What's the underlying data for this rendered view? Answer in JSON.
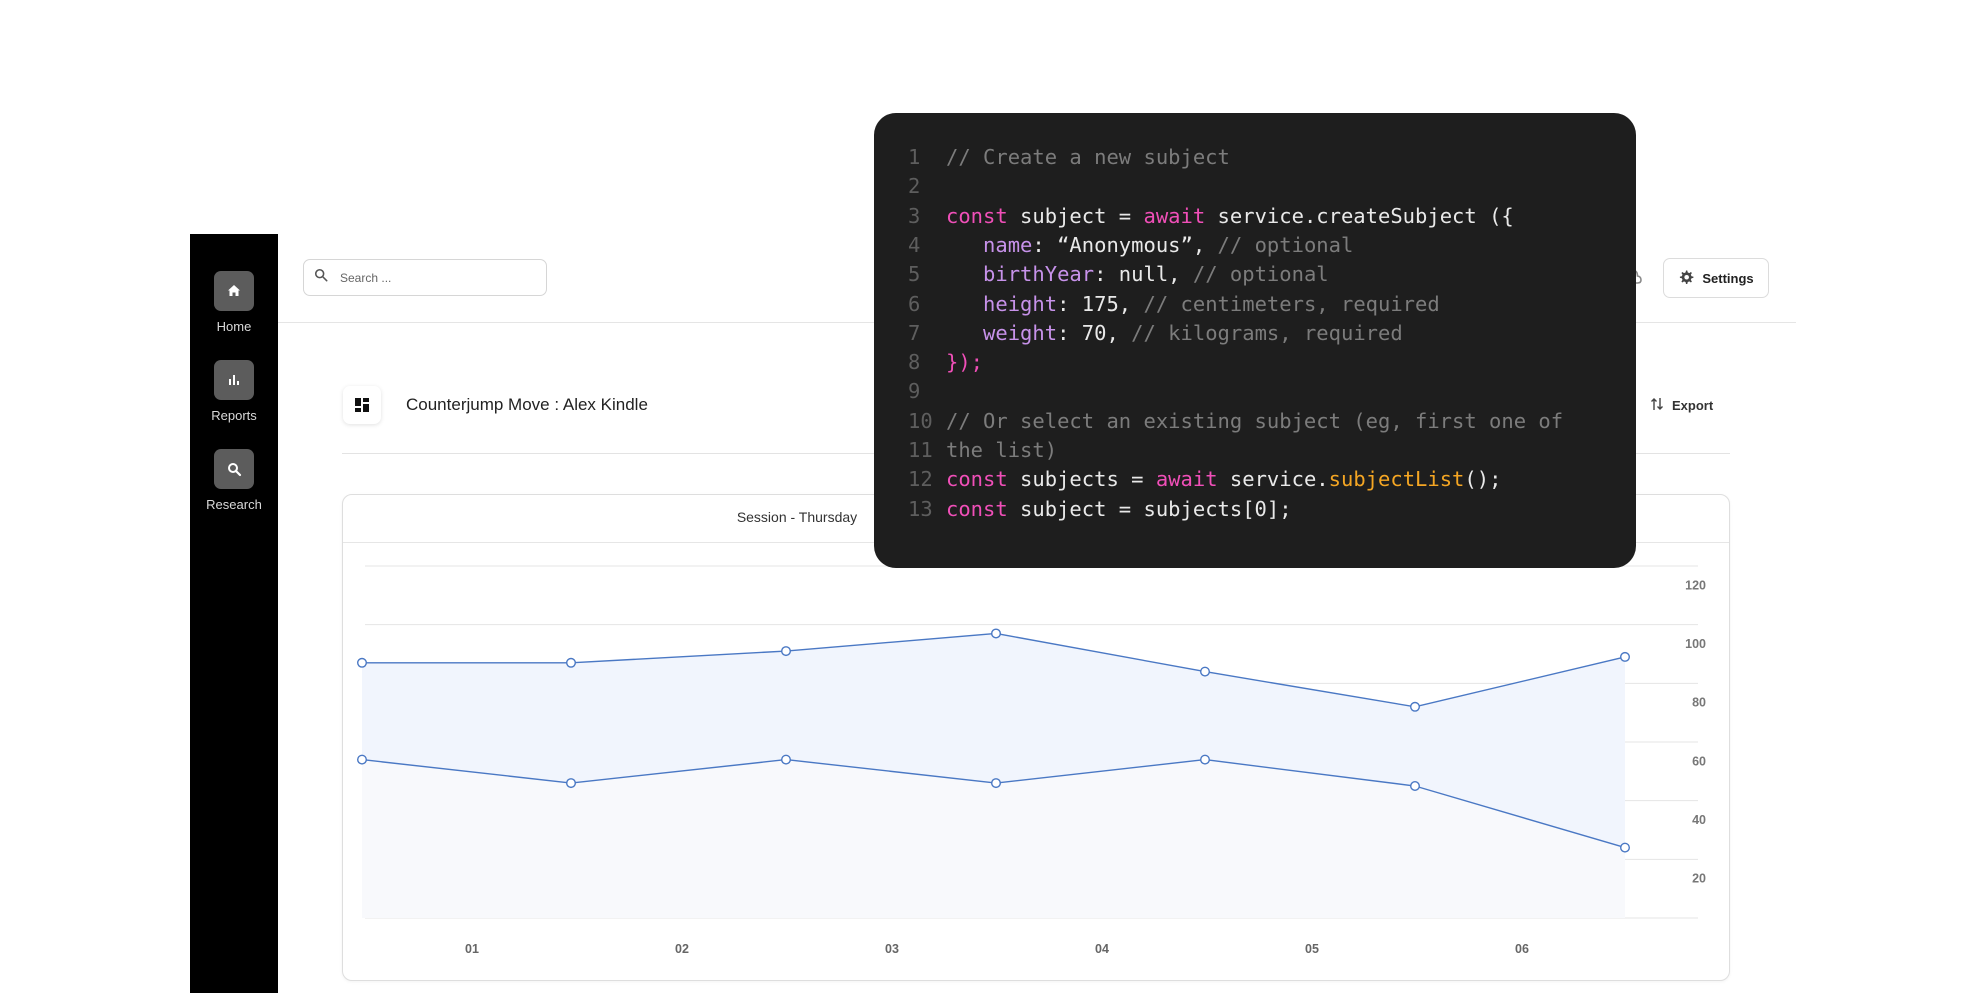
{
  "sidebar": {
    "items": [
      {
        "label": "Home",
        "icon": "home-icon"
      },
      {
        "label": "Reports",
        "icon": "bar-chart-icon"
      },
      {
        "label": "Research",
        "icon": "search-icon"
      }
    ]
  },
  "header": {
    "search_placeholder": "Search ...",
    "settings_label": "Settings"
  },
  "page": {
    "title": "Counterjump Move : Alex Kindle",
    "export_label": "Export"
  },
  "card": {
    "title": "Session - Thursday"
  },
  "code": {
    "lines": [
      {
        "n": "1",
        "segs": [
          {
            "t": "// Create a new subject",
            "c": "cm"
          }
        ]
      },
      {
        "n": "2",
        "segs": []
      },
      {
        "n": "3",
        "segs": [
          {
            "t": "const",
            "c": "kw"
          },
          {
            "t": " subject = ",
            "c": ""
          },
          {
            "t": "await",
            "c": "kw"
          },
          {
            "t": " service.createSubject ({",
            "c": ""
          }
        ]
      },
      {
        "n": "4",
        "segs": [
          {
            "t": "   ",
            "c": ""
          },
          {
            "t": "name",
            "c": "prop"
          },
          {
            "t": ": “Anonymous”, ",
            "c": ""
          },
          {
            "t": "// optional",
            "c": "cm"
          }
        ]
      },
      {
        "n": "5",
        "segs": [
          {
            "t": "   ",
            "c": ""
          },
          {
            "t": "birthYear",
            "c": "prop"
          },
          {
            "t": ": null, ",
            "c": ""
          },
          {
            "t": "// optional",
            "c": "cm"
          }
        ]
      },
      {
        "n": "6",
        "segs": [
          {
            "t": "   ",
            "c": ""
          },
          {
            "t": "height",
            "c": "prop"
          },
          {
            "t": ": 175, ",
            "c": ""
          },
          {
            "t": "// centimeters, required",
            "c": "cm"
          }
        ]
      },
      {
        "n": "7",
        "segs": [
          {
            "t": "   ",
            "c": ""
          },
          {
            "t": "weight",
            "c": "prop"
          },
          {
            "t": ": 70, ",
            "c": ""
          },
          {
            "t": "// kilograms, required",
            "c": "cm"
          }
        ]
      },
      {
        "n": "8",
        "segs": [
          {
            "t": "});",
            "c": "kw"
          }
        ]
      },
      {
        "n": "9",
        "segs": []
      },
      {
        "n": "10",
        "segs": [
          {
            "t": "// Or select an existing subject (eg, first one of",
            "c": "cm"
          }
        ]
      },
      {
        "n": "11",
        "segs": [
          {
            "t": "the list)",
            "c": "cm"
          }
        ]
      },
      {
        "n": "12",
        "segs": [
          {
            "t": "const",
            "c": "kw"
          },
          {
            "t": " subjects = ",
            "c": ""
          },
          {
            "t": "await",
            "c": "kw"
          },
          {
            "t": " service.",
            "c": ""
          },
          {
            "t": "subjectList",
            "c": "fn"
          },
          {
            "t": "();",
            "c": ""
          }
        ]
      },
      {
        "n": "13",
        "segs": [
          {
            "t": "const",
            "c": "kw"
          },
          {
            "t": " subject = subjects[0];",
            "c": ""
          }
        ]
      }
    ]
  },
  "chart_data": {
    "type": "area",
    "x": [
      "",
      "01",
      "02",
      "03",
      "04",
      "05",
      "06",
      ""
    ],
    "xtick_labels": [
      "01",
      "02",
      "03",
      "04",
      "05",
      "06"
    ],
    "y_ticks": [
      20,
      40,
      60,
      80,
      100,
      120
    ],
    "ylim": [
      10,
      130
    ],
    "grid": true,
    "series": [
      {
        "values": [
          97,
          97,
          101,
          107,
          94,
          82,
          99
        ]
      },
      {
        "values": [
          64,
          56,
          64,
          56,
          64,
          55,
          34
        ]
      }
    ],
    "colors": {
      "line": "#4a78c4",
      "fill": "#eef3fc"
    }
  }
}
